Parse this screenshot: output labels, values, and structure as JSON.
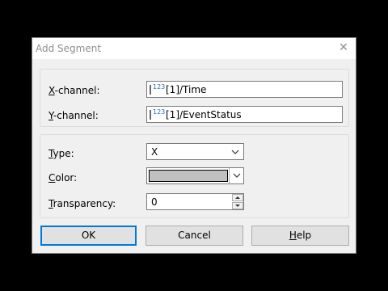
{
  "dialog": {
    "title": "Add Segment",
    "close_glyph": "✕"
  },
  "channels": {
    "x_label_key": "X",
    "x_label_rest": "-channel:",
    "x_value": "[1]/Time",
    "y_label_key": "Y",
    "y_label_rest": "-channel:",
    "y_value": "[1]/EventStatus",
    "channel_badge": "123"
  },
  "properties": {
    "type_label_key": "T",
    "type_label_rest": "ype:",
    "type_value": "X",
    "color_label_key": "C",
    "color_label_rest": "olor:",
    "color_value": "#c0c0c0",
    "transparency_label_key": "T",
    "transparency_label_rest": "ransparency:",
    "transparency_value": "0"
  },
  "buttons": {
    "ok": "OK",
    "cancel": "Cancel",
    "help_key": "H",
    "help_rest": "elp"
  }
}
